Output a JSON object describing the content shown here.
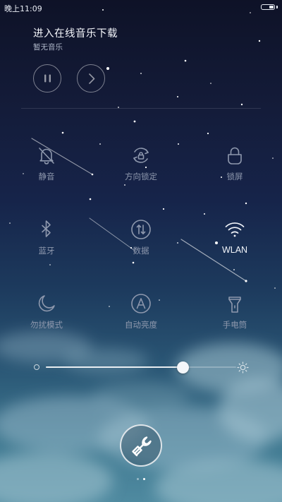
{
  "status_bar": {
    "time": "晚上11:09",
    "battery_icon": "battery-icon",
    "battery_level": 0.35
  },
  "music": {
    "title": "进入在线音乐下载",
    "subtitle": "暂无音乐",
    "controls": [
      {
        "name": "pause",
        "icon": "pause-icon"
      },
      {
        "name": "next",
        "icon": "next-chevron-icon"
      }
    ]
  },
  "toggles": [
    {
      "id": "mute",
      "label": "静音",
      "icon": "bell-off-icon",
      "active": false
    },
    {
      "id": "rotation-lock",
      "label": "方向锁定",
      "icon": "rotation-lock-icon",
      "active": false
    },
    {
      "id": "lock-screen",
      "label": "锁屏",
      "icon": "lock-icon",
      "active": false
    },
    {
      "id": "bluetooth",
      "label": "蓝牙",
      "icon": "bluetooth-icon",
      "active": false
    },
    {
      "id": "mobile-data",
      "label": "数据",
      "icon": "mobile-data-icon",
      "active": false
    },
    {
      "id": "wlan",
      "label": "WLAN",
      "icon": "wifi-icon",
      "active": true
    },
    {
      "id": "do-not-disturb",
      "label": "勿扰模式",
      "icon": "moon-icon",
      "active": false
    },
    {
      "id": "auto-brightness",
      "label": "自动亮度",
      "icon": "auto-brightness-icon",
      "active": false
    },
    {
      "id": "flashlight",
      "label": "手电筒",
      "icon": "flashlight-icon",
      "active": false
    }
  ],
  "brightness": {
    "level": 0.72,
    "min_icon": "brightness-low-icon",
    "max_icon": "brightness-high-icon"
  },
  "settings": {
    "icon": "wrench-icon"
  },
  "pager": {
    "count": 2,
    "active_index": 1
  },
  "colors": {
    "sky_top": "#0e1227",
    "sky_bottom": "#4f8aa0",
    "icon_inactive": "#8e98ad",
    "icon_active": "#f2f5fa"
  }
}
